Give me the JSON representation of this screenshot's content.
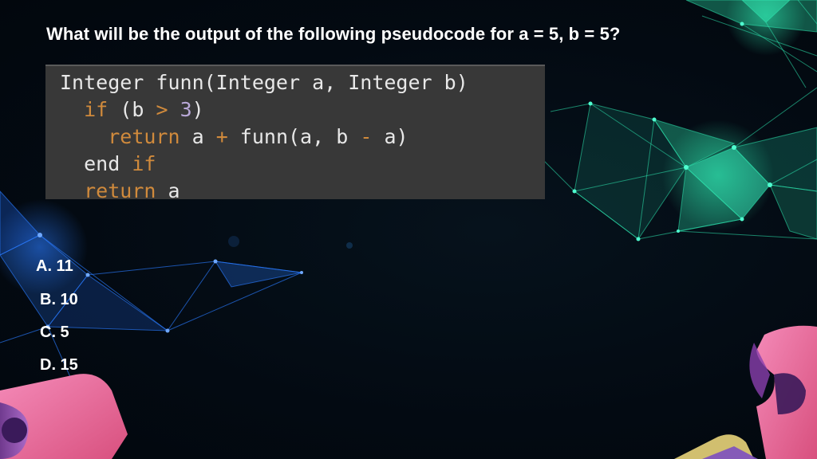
{
  "question": "What will be the output of the following pseudocode for a = 5, b = 5?",
  "code": {
    "line1": {
      "text": "Integer funn(Integer a, Integer b)"
    },
    "line2": {
      "kw_if": "if",
      "open": " (b ",
      "gt": ">",
      "num": "3",
      "close": ")"
    },
    "line3": {
      "kw_return": "return",
      "a": " a ",
      "plus": "+",
      "call": " funn(a, b ",
      "minus": "-",
      "end": " a)"
    },
    "line4": {
      "kw_end": "end",
      "kw_if": "if"
    },
    "line5": {
      "kw_return": "return",
      "a": " a"
    }
  },
  "options": [
    {
      "label": "A. 11"
    },
    {
      "label": "B. 10"
    },
    {
      "label": "C. 5"
    },
    {
      "label": "D. 15"
    }
  ],
  "colors": {
    "background": "#030a12",
    "code_bg": "#383838",
    "keyword": "#d08a3c",
    "number": "#b9a8d8",
    "text": "#ffffff",
    "network_green": "#2ee8b0",
    "network_blue": "#2a7bff",
    "puzzle_pink": "#e86aa0"
  }
}
